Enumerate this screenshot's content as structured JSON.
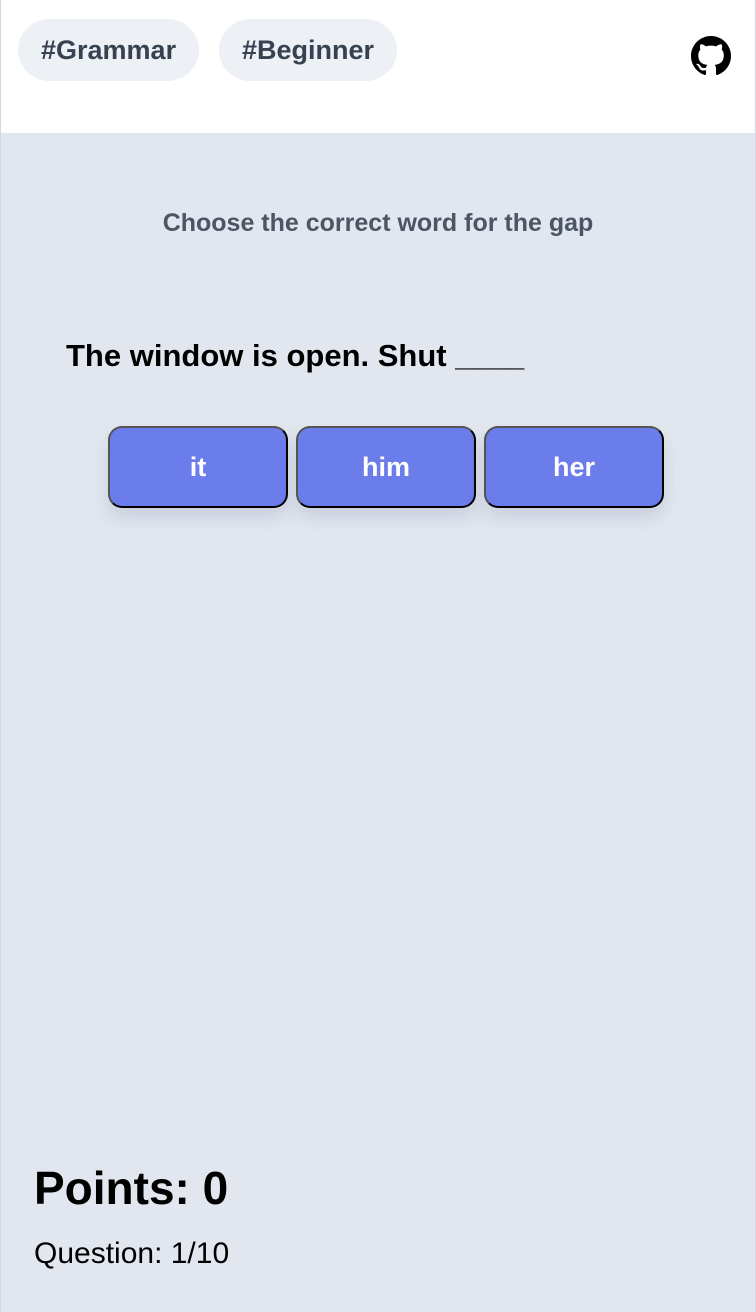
{
  "header": {
    "tags": [
      "#Grammar",
      "#Beginner"
    ],
    "github_icon": "github-icon"
  },
  "quiz": {
    "instruction": "Choose the correct word for the gap",
    "question": "The window is open. Shut ____",
    "options": [
      "it",
      "him",
      "her"
    ],
    "option_color": "#6b7ceb"
  },
  "footer": {
    "points_label": "Points: 0",
    "question_label": "Question: 1/10"
  }
}
